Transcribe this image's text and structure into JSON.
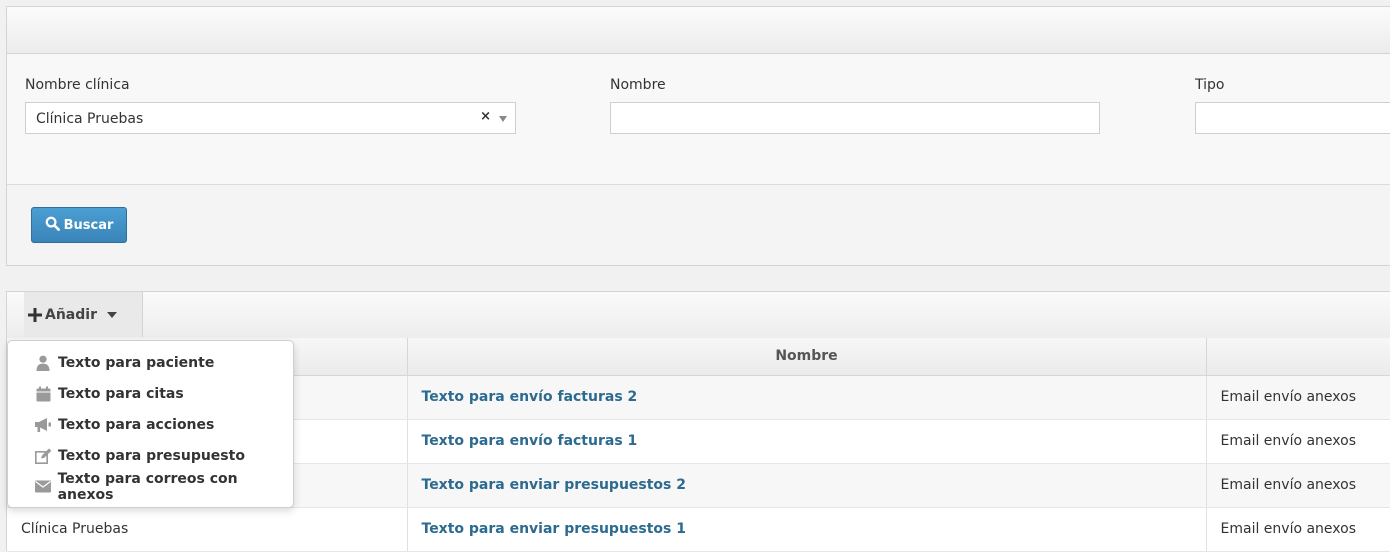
{
  "filters": {
    "clinic_label": "Nombre clínica",
    "clinic_value": "Clínica Pruebas",
    "clinic_clear": "×",
    "name_label": "Nombre",
    "name_value": "",
    "type_label": "Tipo",
    "type_value": "",
    "search_button": "Buscar",
    "search_icon": "search-icon"
  },
  "toolbar": {
    "add_label": "Añadir",
    "add_icon": "plus-icon"
  },
  "add_menu": [
    {
      "label": "Texto para paciente",
      "icon": "user-icon"
    },
    {
      "label": "Texto para citas",
      "icon": "calendar-icon"
    },
    {
      "label": "Texto para acciones",
      "icon": "bullhorn-icon"
    },
    {
      "label": "Texto para presupuesto",
      "icon": "edit-icon"
    },
    {
      "label": "Texto para correos con anexos",
      "icon": "envelope-icon"
    }
  ],
  "table": {
    "columns": [
      "",
      "Nombre",
      ""
    ],
    "rows": [
      {
        "clinic": "",
        "name": "Texto para envío facturas 2",
        "type": "Email envío anexos"
      },
      {
        "clinic": "",
        "name": "Texto para envío facturas 1",
        "type": "Email envío anexos"
      },
      {
        "clinic": "",
        "name": "Texto para enviar presupuestos 2",
        "type": "Email envío anexos"
      },
      {
        "clinic": "Clínica Pruebas",
        "name": "Texto para enviar presupuestos 1",
        "type": "Email envío anexos"
      }
    ]
  },
  "colors": {
    "primary_button": "#3a84b9",
    "link": "#2c6a8f",
    "icon_gray": "#9a9a9a"
  }
}
